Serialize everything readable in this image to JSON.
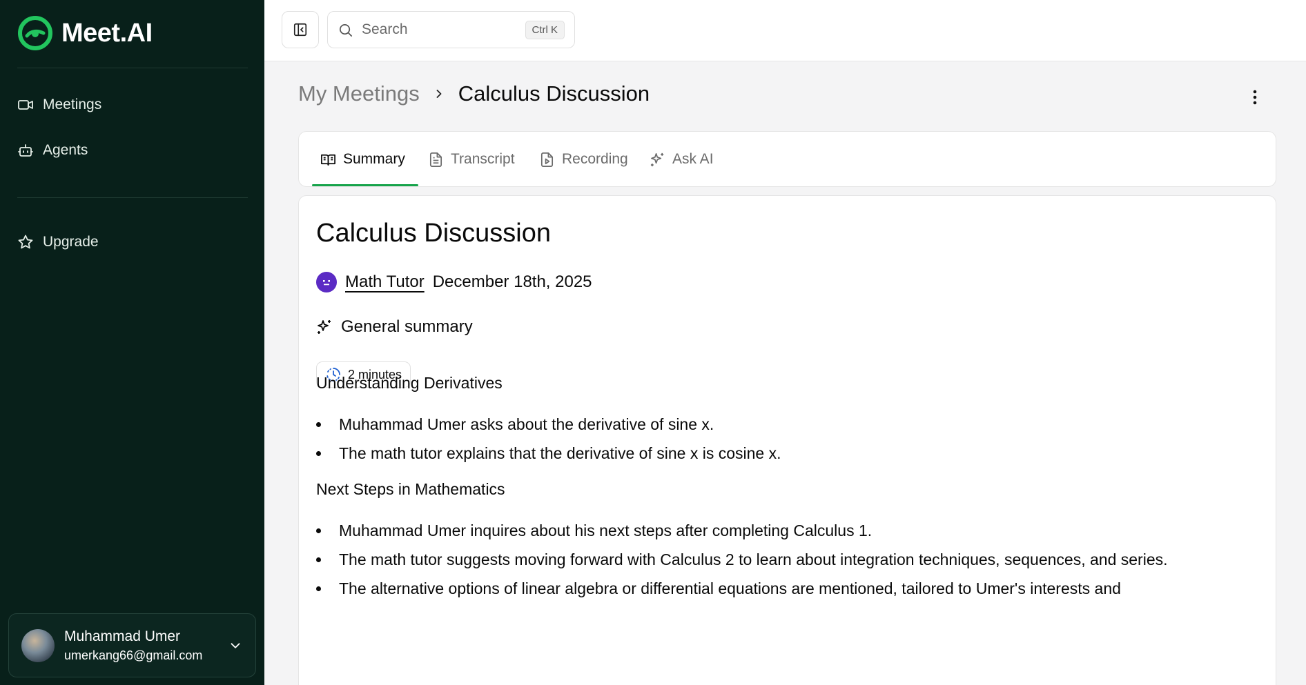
{
  "app": {
    "name": "Meet.AI"
  },
  "sidebar": {
    "nav": [
      {
        "label": "Meetings",
        "icon": "video-icon"
      },
      {
        "label": "Agents",
        "icon": "bot-icon"
      }
    ],
    "upgrade": {
      "label": "Upgrade",
      "icon": "star-icon"
    },
    "user": {
      "name": "Muhammad Umer",
      "email": "umerkang66@gmail.com"
    }
  },
  "topbar": {
    "search_placeholder": "Search",
    "search_shortcut": "Ctrl K"
  },
  "breadcrumb": {
    "parent": "My Meetings",
    "current": "Calculus Discussion"
  },
  "tabs": [
    {
      "label": "Summary",
      "icon": "book-open-icon",
      "active": true
    },
    {
      "label": "Transcript",
      "icon": "file-text-icon",
      "active": false
    },
    {
      "label": "Recording",
      "icon": "file-video-icon",
      "active": false
    },
    {
      "label": "Ask AI",
      "icon": "sparkles-icon",
      "active": false
    }
  ],
  "meeting": {
    "title": "Calculus Discussion",
    "agent": "Math Tutor",
    "date": "December 18th, 2025",
    "summary_heading": "General summary",
    "duration": "2 minutes",
    "sections": [
      {
        "heading": "Understanding Derivatives",
        "items": [
          "Muhammad Umer asks about the derivative of sine x.",
          "The math tutor explains that the derivative of sine x is cosine x."
        ]
      },
      {
        "heading": "Next Steps in Mathematics",
        "items": [
          "Muhammad Umer inquires about his next steps after completing Calculus 1.",
          "The math tutor suggests moving forward with Calculus 2 to learn about integration techniques, sequences, and series.",
          "The alternative options of linear algebra or differential equations are mentioned, tailored to Umer's interests and"
        ]
      }
    ]
  },
  "colors": {
    "sidebar_bg": "#08201a",
    "accent": "#16a34a",
    "agent_avatar": "#5b2bc4"
  }
}
